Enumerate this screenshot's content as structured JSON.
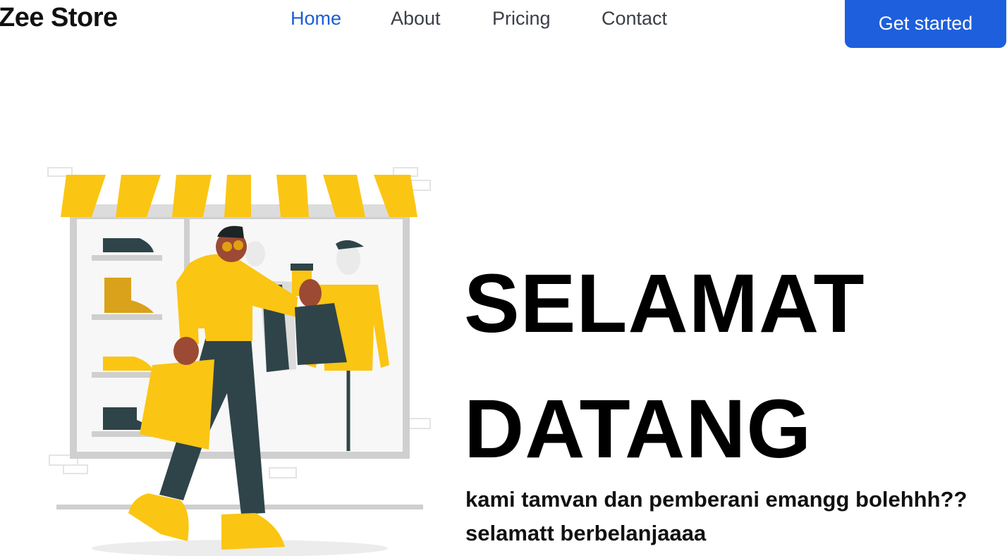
{
  "brand": {
    "name": "Zee Store"
  },
  "nav": {
    "items": [
      {
        "label": "Home",
        "active": true
      },
      {
        "label": "About",
        "active": false
      },
      {
        "label": "Pricing",
        "active": false
      },
      {
        "label": "Contact",
        "active": false
      }
    ],
    "cta_label": "Get started"
  },
  "hero": {
    "title_line1": "SELAMAT",
    "title_line2": "DATANG",
    "tagline_line1": "kami tamvan dan pemberani emangg bolehhh??",
    "tagline_line2": "selamatt berbelanjaaaa"
  },
  "colors": {
    "accent": "#1d5fdc",
    "nav_active": "#1a5fd6",
    "awning_yellow": "#fbc513",
    "outfit_dark": "#2f4449"
  }
}
